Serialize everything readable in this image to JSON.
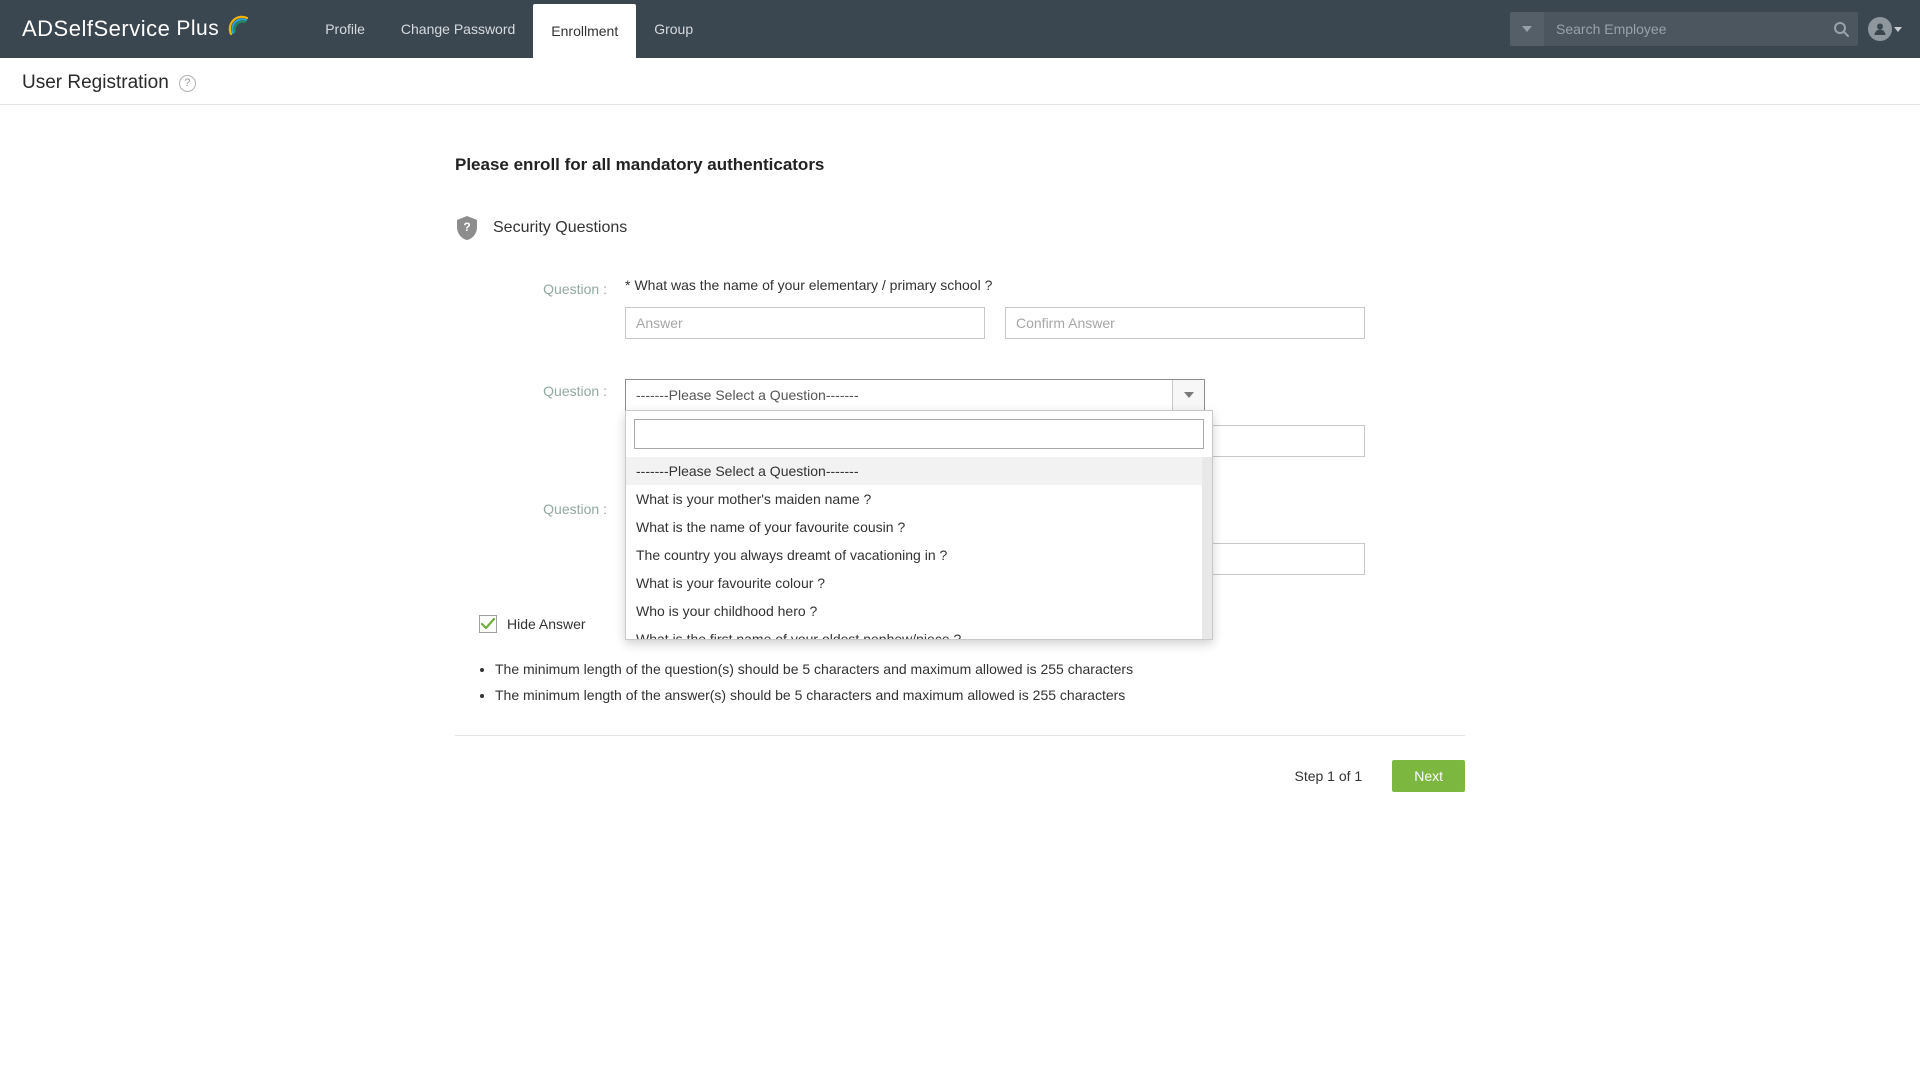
{
  "header": {
    "logo_main": "ADSelfService",
    "logo_plus": "Plus",
    "nav": [
      "Profile",
      "Change Password",
      "Enrollment",
      "Group"
    ],
    "active_nav_index": 2,
    "search_placeholder": "Search Employee"
  },
  "subheader": {
    "title": "User Registration"
  },
  "main": {
    "instruction": "Please enroll for all mandatory authenticators",
    "section_title": "Security Questions",
    "question_label": "Question :",
    "q1_text": "What was the name of your elementary / primary school ?",
    "q1_mandatory": "*",
    "answer_placeholder": "Answer",
    "confirm_placeholder": "Confirm Answer",
    "dd_selected": "-------Please Select a Question-------",
    "dd_options": [
      "-------Please Select a Question-------",
      "What is your mother's maiden name ?",
      "What is the name of your favourite cousin ?",
      "The country you always dreamt of vacationing in ?",
      "What is your favourite colour ?",
      "Who is your childhood hero ?",
      "What is the first name of your oldest nephew/niece ?"
    ],
    "hide_answers_label": "Hide Answer",
    "rules": [
      "The minimum length of the question(s) should be 5 characters and maximum allowed is 255 characters",
      "The minimum length of the answer(s) should be 5 characters and maximum allowed is 255 characters"
    ],
    "step_text": "Step 1 of 1",
    "next_label": "Next"
  }
}
